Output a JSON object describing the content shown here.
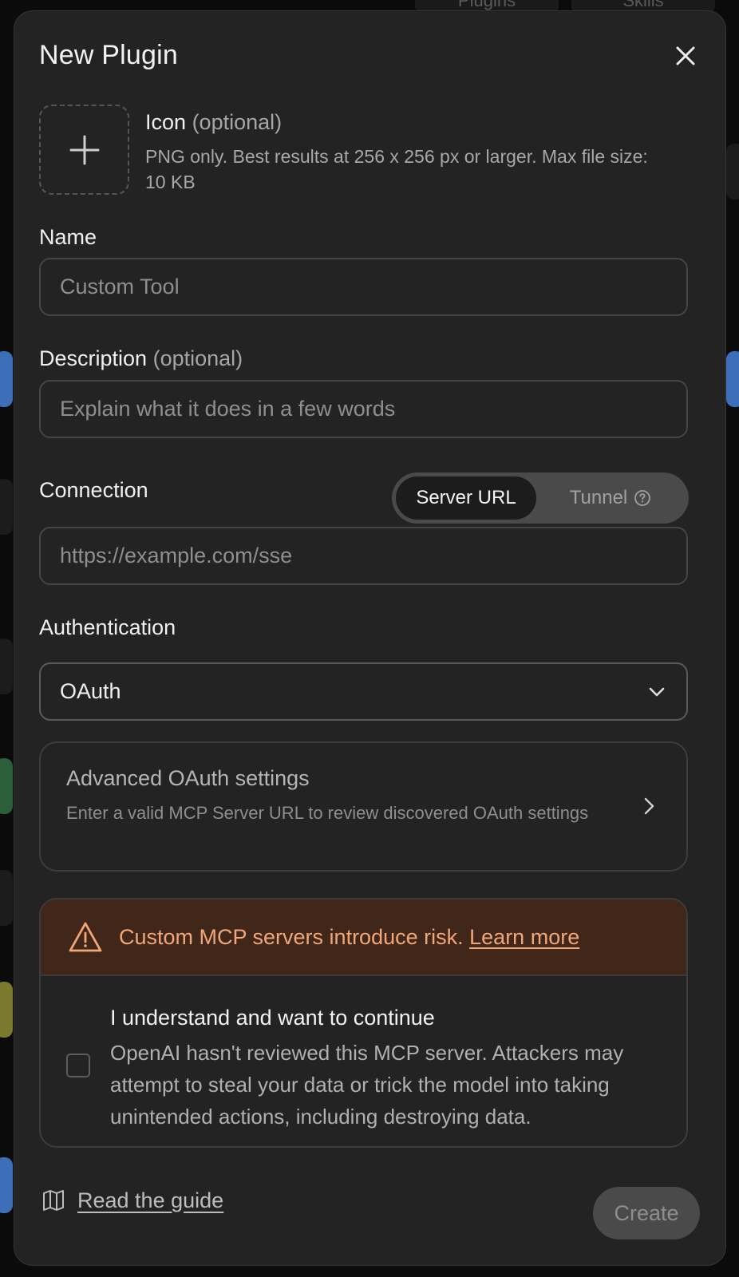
{
  "background": {
    "tabs": [
      "Plugins",
      "Skills"
    ]
  },
  "modal": {
    "title": "New Plugin",
    "icon_section": {
      "label": "Icon",
      "optional": "(optional)",
      "help": "PNG only. Best results at 256 x 256 px or larger. Max file size: 10 KB"
    },
    "name": {
      "label": "Name",
      "placeholder": "Custom Tool",
      "value": ""
    },
    "description": {
      "label": "Description",
      "optional": "(optional)",
      "placeholder": "Explain what it does in a few words",
      "value": ""
    },
    "connection": {
      "label": "Connection",
      "options": [
        "Server URL",
        "Tunnel"
      ],
      "selected": "Server URL",
      "placeholder": "https://example.com/sse",
      "value": ""
    },
    "authentication": {
      "label": "Authentication",
      "selected": "OAuth"
    },
    "advanced": {
      "title": "Advanced OAuth settings",
      "subtitle": "Enter a valid MCP Server URL to review discovered OAuth settings"
    },
    "warning": {
      "text": "Custom MCP servers introduce risk.",
      "link": "Learn more",
      "color": "#f0a77a",
      "background": "#41261a"
    },
    "acknowledgement": {
      "title": "I understand and want to continue",
      "body": "OpenAI hasn't reviewed this MCP server. Attackers may attempt to steal your data or trick the model into taking unintended actions, including destroying data.",
      "checked": false
    },
    "footer": {
      "guide_label": "Read the guide",
      "create_label": "Create"
    }
  },
  "icons": {
    "close": "close-icon",
    "add": "plus-icon",
    "help": "question-circle-icon",
    "dropdown": "chevron-down-icon",
    "expand": "chevron-right-icon",
    "warning": "warning-triangle-icon",
    "guide": "book-icon"
  }
}
